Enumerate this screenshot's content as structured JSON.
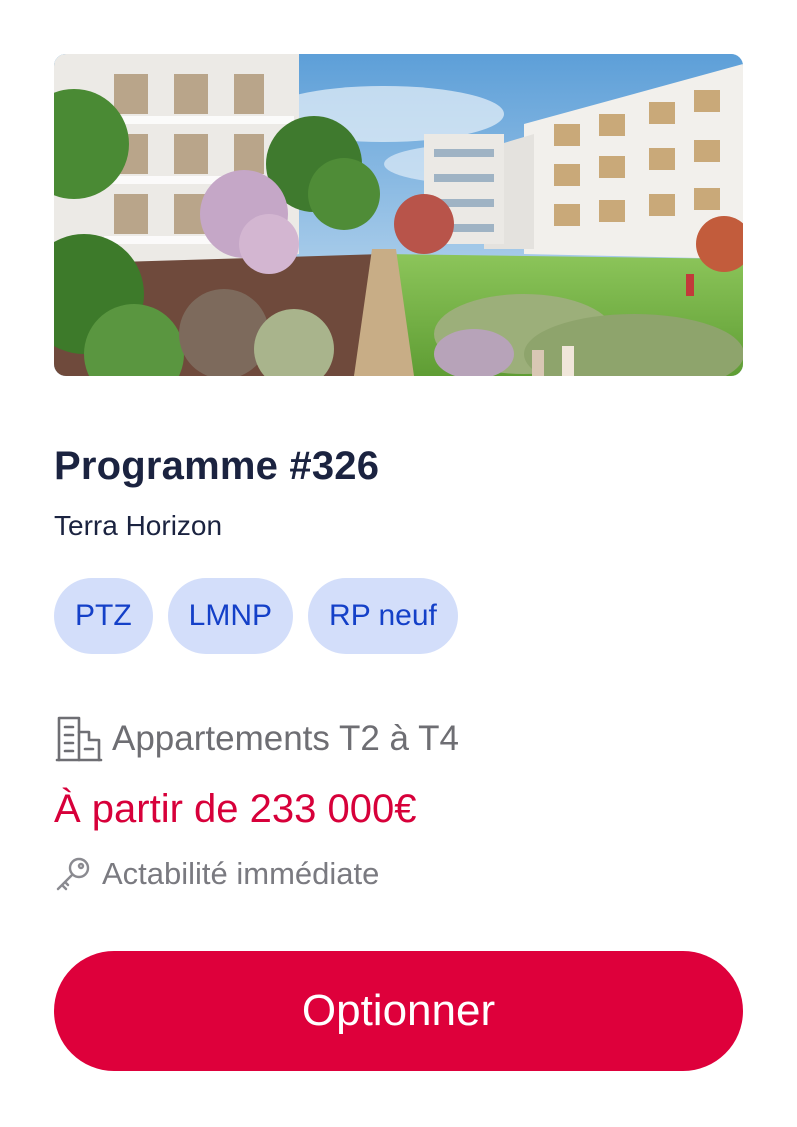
{
  "program": {
    "title": "Programme #326",
    "name": "Terra Horizon"
  },
  "tags": [
    "PTZ",
    "LMNP",
    "RP neuf"
  ],
  "details": {
    "type_icon": "building-icon",
    "type_text": "Appartements T2 à T4",
    "price_text": "À partir de 233 000€",
    "availability_icon": "key-icon",
    "availability_text": "Actabilité immédiate"
  },
  "cta": {
    "label": "Optionner"
  },
  "colors": {
    "title": "#1b2340",
    "tag_bg": "#d3defa",
    "tag_text": "#1440c8",
    "muted": "#6e6e73",
    "price": "#d7003a",
    "button_bg": "#de003b",
    "button_text": "#ffffff"
  }
}
